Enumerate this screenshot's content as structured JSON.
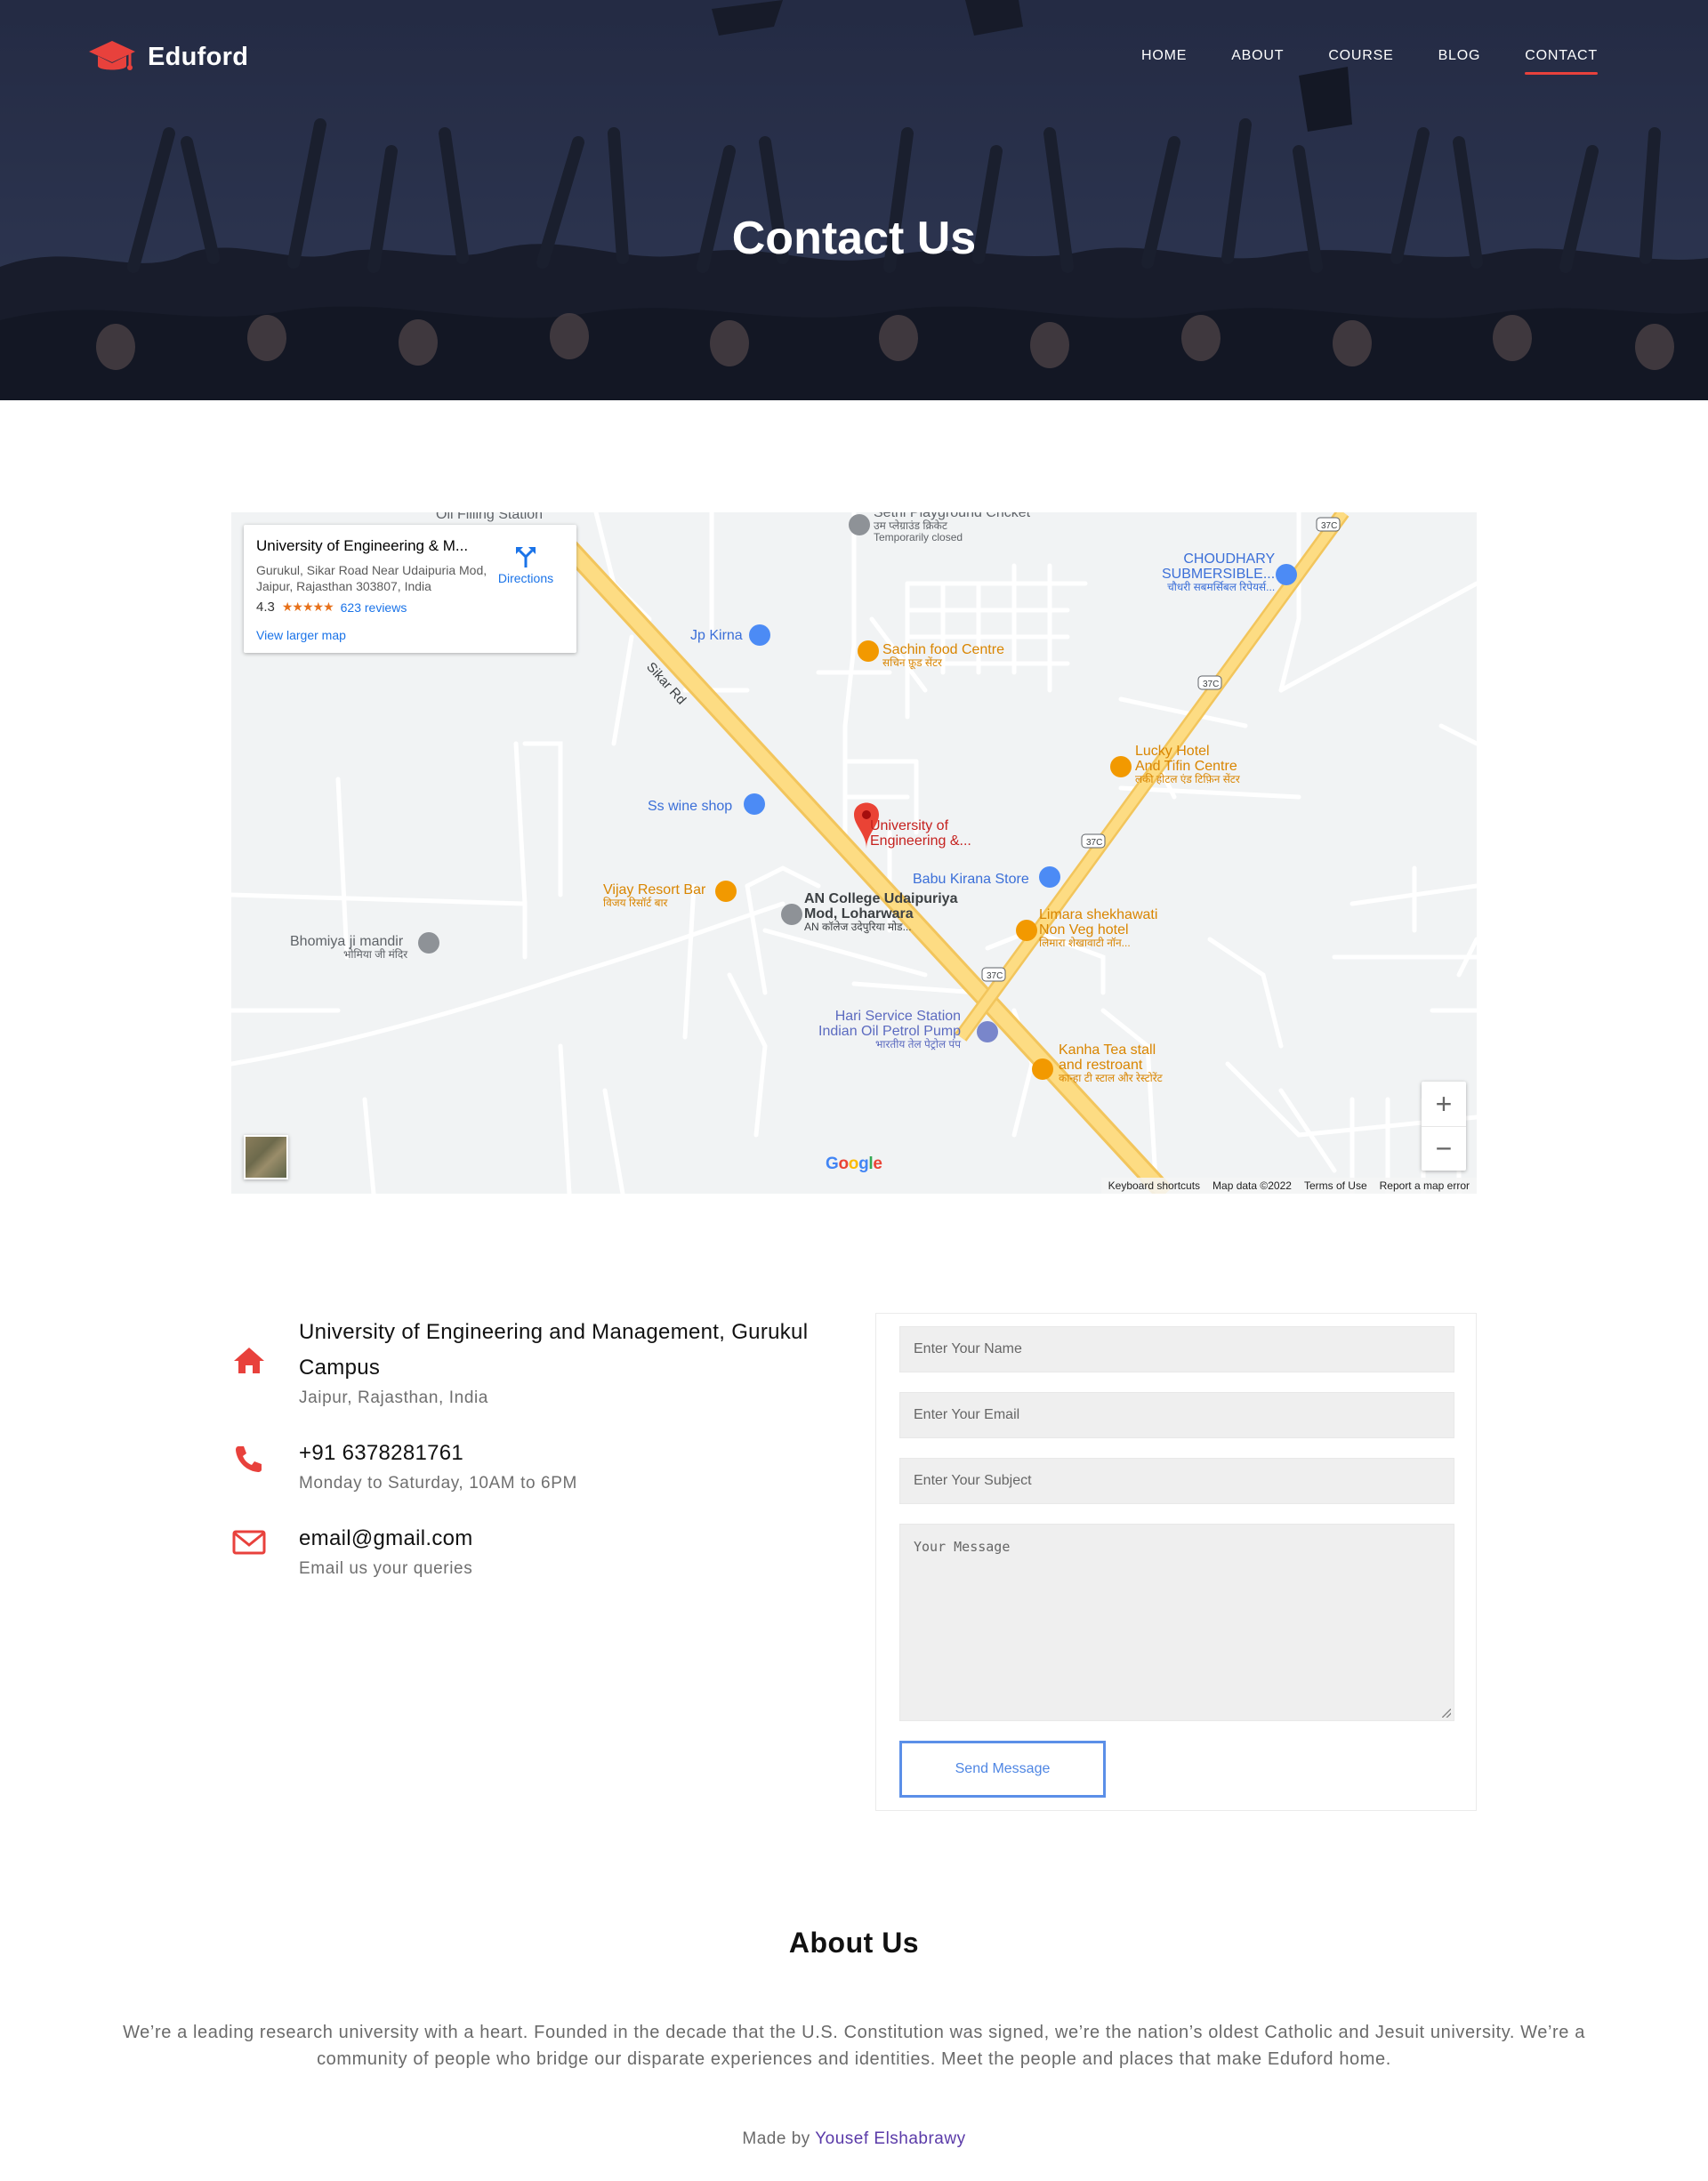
{
  "brand": {
    "name": "Eduford",
    "accent": "#e8413c"
  },
  "nav": {
    "items": [
      {
        "label": "HOME"
      },
      {
        "label": "ABOUT"
      },
      {
        "label": "COURSE"
      },
      {
        "label": "BLOG"
      },
      {
        "label": "CONTACT",
        "active": true
      }
    ]
  },
  "hero": {
    "title": "Contact Us"
  },
  "map": {
    "card": {
      "place_name": "University of Engineering & M...",
      "address": "Gurukul, Sikar Road Near Udaipuria Mod, Jaipur, Rajasthan 303807, India",
      "rating": "4.3",
      "stars": "★★★★★",
      "reviews": "623 reviews",
      "directions": "Directions",
      "larger_map": "View larger map"
    },
    "labels": {
      "playground": "Sethi Playground Cricket",
      "playground_hi": "उम प्लेग्राउंड क्रिकेट",
      "playground_status": "Temporarily closed",
      "filling": "Oil Filling Station",
      "choudhary": "CHOUDHARY",
      "choudhary2": "SUBMERSIBLE...",
      "choudhary_hi": "चौधरी सबमर्सिबल रिपेयर्स...",
      "jp_kirna": "Jp Kirna",
      "sachin": "Sachin food Centre",
      "sachin_hi": "सचिन फ़ूड सेंटर",
      "sikar_rd": "Sikar Rd",
      "lucky": "Lucky Hotel",
      "lucky2": "And Tifin Centre",
      "lucky_hi": "लकी होटल एंड टिफ़िन सेंटर",
      "ss_wine": "Ss wine shop",
      "university": "University of",
      "university2": "Engineering &...",
      "babu": "Babu Kirana Store",
      "vijay": "Vijay Resort Bar",
      "vijay_hi": "विजय रिसॉर्ट बार",
      "an_college": "AN College Udaipuriya",
      "an_college2": "Mod, Loharwara",
      "an_college_hi": "AN कॉलेज उदेपुरिया मोड...",
      "limara": "Limara shekhawati",
      "limara2": "Non Veg hotel",
      "limara_hi": "लिमारा शेखावाटी नॉन...",
      "bhomiya": "Bhomiya ji mandir",
      "bhomiya_hi": "भोमिया जी मंदिर",
      "hari": "Hari Service Station",
      "hari2": "Indian Oil Petrol Pump",
      "hari_hi": "भारतीय तेल पेट्रोल पंप",
      "kanha": "Kanha Tea stall",
      "kanha2": "and restroant",
      "kanha_hi": "कान्हा टी स्टाल और रेस्टोरेंट",
      "route": "37C"
    },
    "zoom_in": "+",
    "zoom_out": "−",
    "google": "Google",
    "footer": {
      "shortcuts": "Keyboard shortcuts",
      "data": "Map data ©2022",
      "terms": "Terms of Use",
      "report": "Report a map error"
    }
  },
  "contact": {
    "address_title": "University of Engineering and Management, Gurukul Campus",
    "address_sub": "Jaipur, Rajasthan, India",
    "phone_title": "+91 6378281761",
    "phone_sub": "Monday to Saturday, 10AM to 6PM",
    "email_title": "email@gmail.com",
    "email_sub": "Email us your queries"
  },
  "form": {
    "name_placeholder": "Enter Your Name",
    "email_placeholder": "Enter Your Email",
    "subject_placeholder": "Enter Your Subject",
    "message_placeholder": "Your Message",
    "send_label": "Send Message"
  },
  "about": {
    "title": "About Us",
    "text": "We’re a leading research university with a heart. Founded in the decade that the U.S. Constitution was signed, we’re the nation’s oldest Catholic and Jesuit university. We’re a community of people who bridge our disparate experiences and identities. Meet the people and places that make Eduford home."
  },
  "footer": {
    "made_by_prefix": "Made by",
    "author": "Yousef Elshabrawy"
  }
}
